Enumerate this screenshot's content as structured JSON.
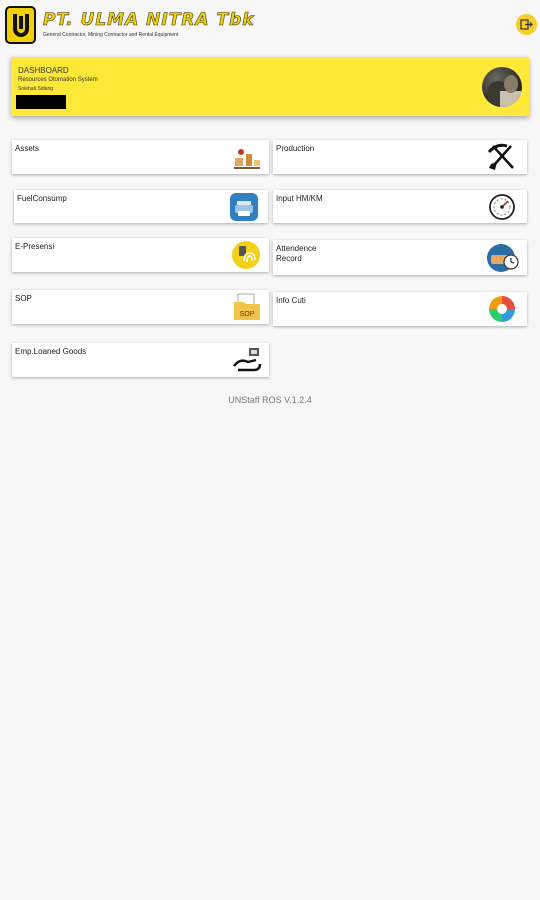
{
  "header": {
    "brand_title": "PT. ULMA NITRA Tbk",
    "brand_subtitle": "General Contractor, Mining Contractor and Rental Equipment"
  },
  "banner": {
    "title": "DASHBOARD",
    "subtitle": "Resources Otomation System",
    "user_name": "Solehati Sidang"
  },
  "menu": [
    {
      "label": "Assets",
      "icon": "assets-icon"
    },
    {
      "label": "Production",
      "icon": "shovel-pick-icon"
    },
    {
      "label": "FuelConsump",
      "icon": "fuel-printer-icon"
    },
    {
      "label": "Input HM/KM",
      "icon": "gauge-icon"
    },
    {
      "label": "E-Presensi",
      "icon": "fingerprint-icon"
    },
    {
      "label": "Attendence\nRecord",
      "icon": "attendance-icon"
    },
    {
      "label": "SOP",
      "icon": "sop-folder-icon"
    },
    {
      "label": "Info Cuti",
      "icon": "leave-info-icon"
    },
    {
      "label": "Emp.Loaned Goods",
      "icon": "handover-icon"
    }
  ],
  "sop_icon_text": "SOP",
  "version": "UNStaff ROS V.1.2.4",
  "colors": {
    "accent_yellow": "#ffe838",
    "brand_yellow": "#f3d100",
    "background": "#f7f7f7"
  }
}
